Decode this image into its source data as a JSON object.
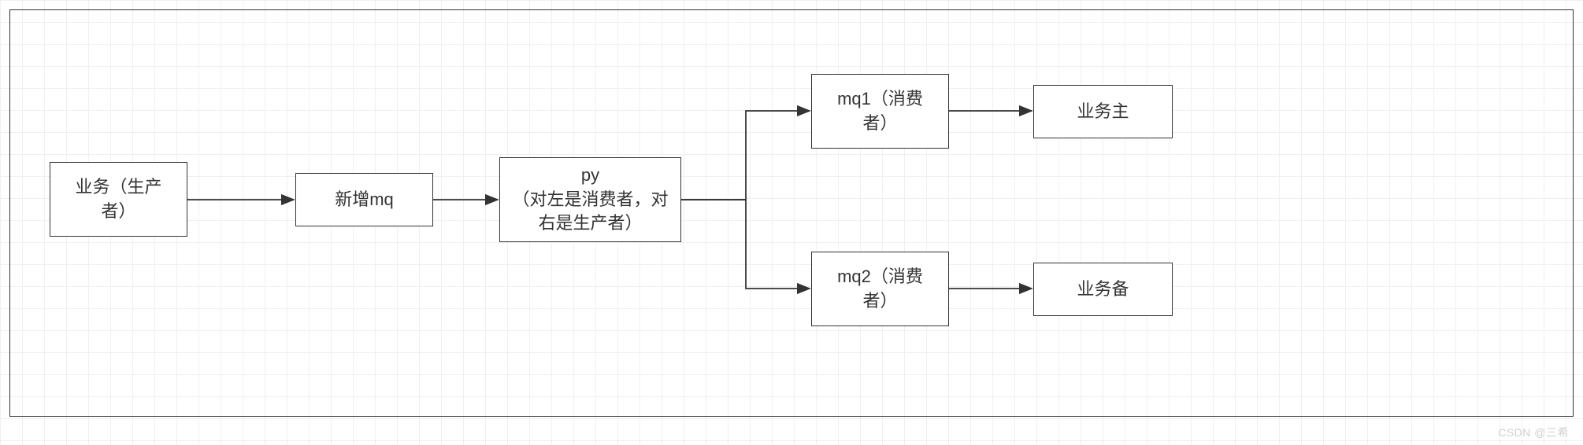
{
  "nodes": {
    "producer": {
      "line1": "业务（生产",
      "line2": "者）"
    },
    "new_mq": "新增mq",
    "py": {
      "line1": "py",
      "line2": "（对左是消费者，对",
      "line3": "右是生产者）"
    },
    "mq1": {
      "line1": "mq1（消费",
      "line2": "者）"
    },
    "mq2": {
      "line1": "mq2（消费",
      "line2": "者）"
    },
    "biz_main": "业务主",
    "biz_backup": "业务备"
  },
  "watermark": "CSDN @三希"
}
